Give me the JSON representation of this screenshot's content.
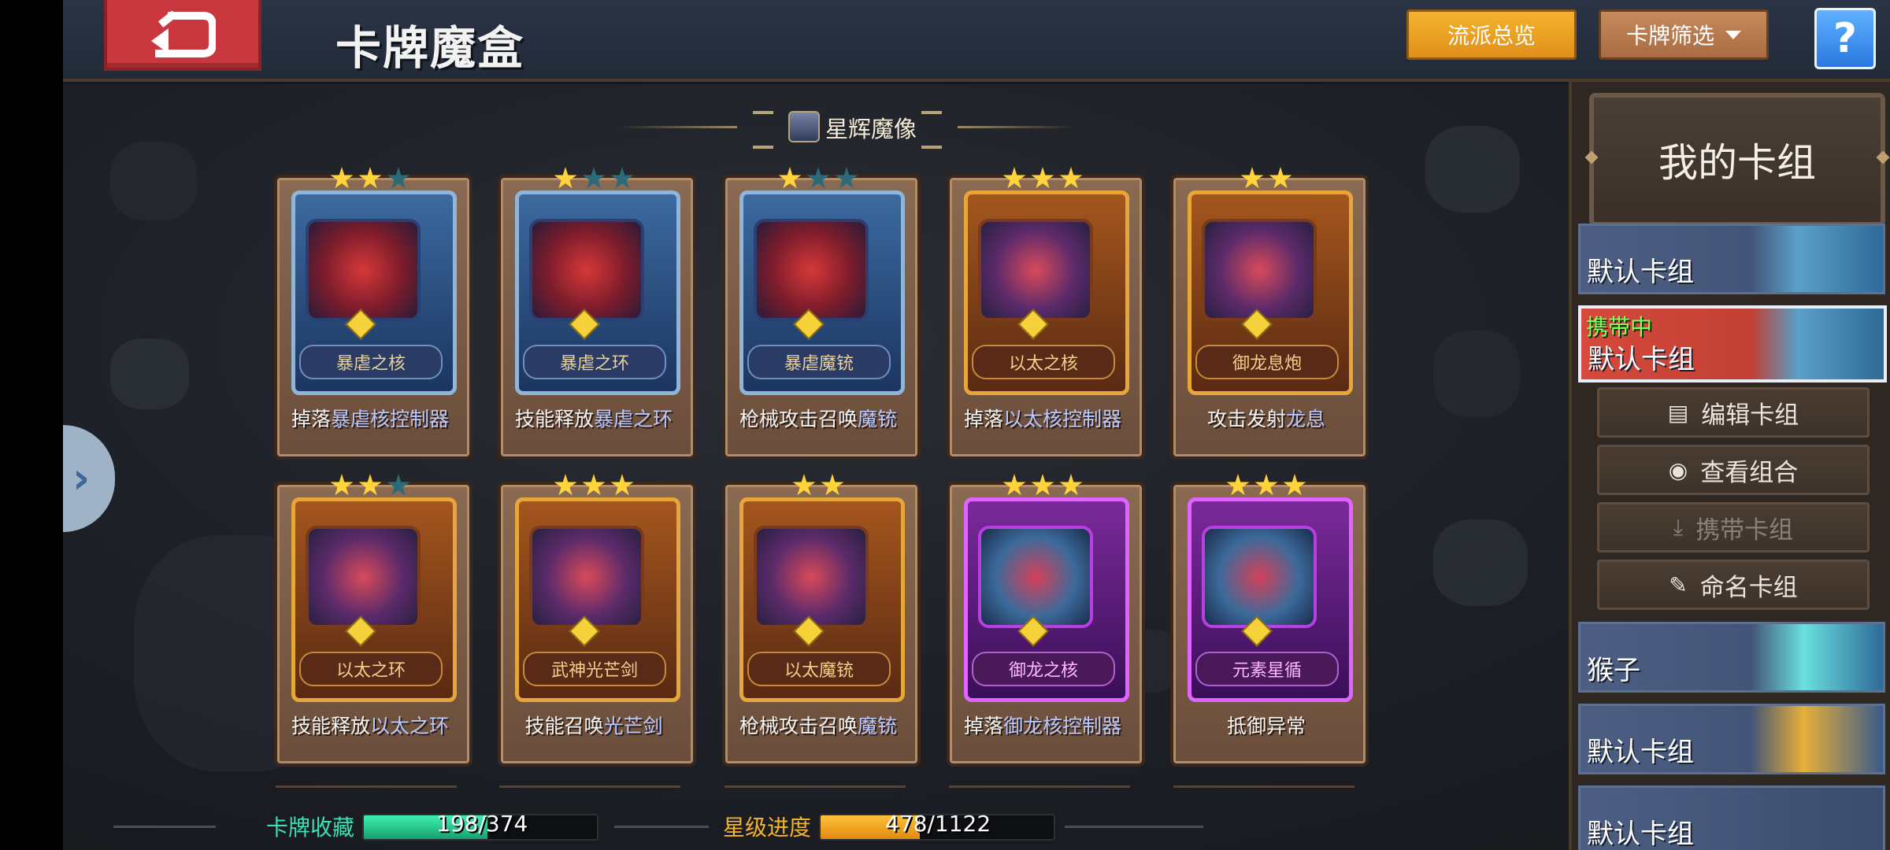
{
  "header": {
    "title": "卡牌魔盒",
    "overview_label": "流派总览",
    "filter_label": "卡牌筛选",
    "help_label": "?"
  },
  "section": {
    "title": "星辉魔像"
  },
  "cards": [
    {
      "name": "暴虐之核",
      "desc_pre": "掉落",
      "desc_hl": "暴虐核控制器",
      "desc_post": "",
      "stars": 3,
      "lit": 2,
      "rarity": "blue"
    },
    {
      "name": "暴虐之环",
      "desc_pre": "技能释放",
      "desc_hl": "暴虐之环",
      "desc_post": "",
      "stars": 3,
      "lit": 1,
      "rarity": "blue"
    },
    {
      "name": "暴虐魔铳",
      "desc_pre": "枪械攻击召唤",
      "desc_hl": "魔铳",
      "desc_post": "",
      "stars": 3,
      "lit": 1,
      "rarity": "blue"
    },
    {
      "name": "以太之核",
      "desc_pre": "掉落",
      "desc_hl": "以太核控制器",
      "desc_post": "",
      "stars": 3,
      "lit": 3,
      "rarity": "gold"
    },
    {
      "name": "御龙息炮",
      "desc_pre": "攻击发射",
      "desc_hl": "龙息",
      "desc_post": "",
      "stars": 2,
      "lit": 2,
      "rarity": "gold"
    },
    {
      "name": "以太之环",
      "desc_pre": "技能释放",
      "desc_hl": "以太之环",
      "desc_post": "",
      "stars": 3,
      "lit": 2,
      "rarity": "gold"
    },
    {
      "name": "武神光芒剑",
      "desc_pre": "技能召唤",
      "desc_hl": "光芒剑",
      "desc_post": "",
      "stars": 3,
      "lit": 3,
      "rarity": "gold"
    },
    {
      "name": "以太魔铳",
      "desc_pre": "枪械攻击召唤",
      "desc_hl": "魔铳",
      "desc_post": "",
      "stars": 2,
      "lit": 2,
      "rarity": "gold"
    },
    {
      "name": "御龙之核",
      "desc_pre": "掉落",
      "desc_hl": "御龙核控制器",
      "desc_post": "",
      "stars": 3,
      "lit": 3,
      "rarity": "purple"
    },
    {
      "name": "元素星循",
      "desc_pre": "抵御异常",
      "desc_hl": "",
      "desc_post": "",
      "stars": 3,
      "lit": 3,
      "rarity": "purple"
    }
  ],
  "stats": {
    "collection_label": "卡牌收藏",
    "collection_value": "198/374",
    "collection_ratio": 0.529,
    "star_label": "星级进度",
    "star_value": "478/1122",
    "star_ratio": 0.426
  },
  "panel": {
    "title": "我的卡组",
    "decks": [
      {
        "name": "默认卡组",
        "tag": ""
      },
      {
        "name": "默认卡组",
        "tag": "携带中"
      },
      {
        "name": "猴子",
        "tag": ""
      },
      {
        "name": "默认卡组",
        "tag": ""
      },
      {
        "name": "默认卡组",
        "tag": ""
      }
    ],
    "actions": {
      "edit": "编辑卡组",
      "view": "查看组合",
      "carry": "携带卡组",
      "rename": "命名卡组"
    }
  },
  "colors": {
    "accent_orange": "#f5b22e",
    "active_red": "#d54a3c",
    "collection_bar": "#22c48a",
    "star_bar": "#f0a21c"
  }
}
